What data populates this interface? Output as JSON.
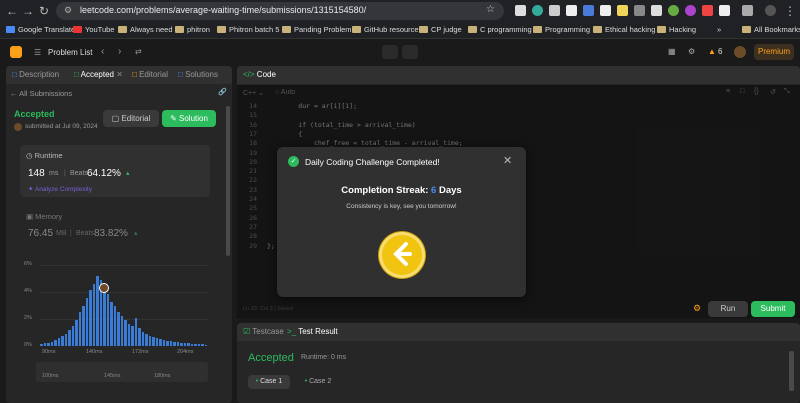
{
  "browser": {
    "url": "leetcode.com/problems/average-waiting-time/submissions/1315154580/",
    "bookmarks": [
      {
        "label": "Google Translate"
      },
      {
        "label": "YouTube"
      },
      {
        "label": "Always need"
      },
      {
        "label": "phitron"
      },
      {
        "label": "Phitron batch 5"
      },
      {
        "label": "Panding Problem"
      },
      {
        "label": "GitHub resource"
      },
      {
        "label": "CP judge"
      },
      {
        "label": "C programming"
      },
      {
        "label": "Programming"
      },
      {
        "label": "Ethical hacking"
      },
      {
        "label": "Hacking"
      }
    ],
    "all_bookmarks": "All Bookmarks",
    "overflow": "»"
  },
  "header": {
    "problem_list": "Problem List",
    "streak": "6",
    "premium": "Premium"
  },
  "left": {
    "tabs": [
      "Description",
      "Accepted",
      "Editorial",
      "Solutions"
    ],
    "back": "All Submissions",
    "status": "Accepted",
    "submitted": "submitted at Jul 09, 2024",
    "editorial_btn": "Editorial",
    "solution_btn": "Solution",
    "runtime": {
      "label": "Runtime",
      "value": "148",
      "unit": "ms",
      "beats_label": "Beats",
      "beats": "64.12%",
      "analyze": "Analyze Complexity"
    },
    "memory": {
      "label": "Memory",
      "value": "76.45",
      "unit": "MB",
      "beats_label": "Beats",
      "beats": "83.82%"
    },
    "chart": {
      "y_ticks": [
        "6%",
        "4%",
        "2%",
        "0%"
      ],
      "x_ticks": [
        "90ms",
        "140ms",
        "172ms",
        "204ms"
      ],
      "mini_ticks": [
        "100ms",
        "145ms",
        "180ms"
      ]
    }
  },
  "code": {
    "title": "Code",
    "language": "C++",
    "mode": "Auto",
    "line_numbers": [
      "14",
      "15",
      "16",
      "17",
      "18",
      "19",
      "20",
      "21",
      "22",
      "23",
      "24",
      "25",
      "26",
      "27",
      "28",
      "29"
    ],
    "lines": [
      "        dur = ar[i][1];",
      "",
      "        if (total_time > arrival_time)",
      "        {",
      "            chef_free = total_time - arrival_time;",
      "",
      "",
      "",
      "",
      "",
      "",
      "",
      "",
      "",
      "",
      "};"
    ],
    "status": "Ln 29, Col 3",
    "saved": "Saved",
    "run": "Run",
    "submit": "Submit"
  },
  "bottom": {
    "tabs": [
      "Testcase",
      "Test Result"
    ],
    "result": "Accepted",
    "runtime": "Runtime: 0 ms",
    "cases": [
      "Case 1",
      "Case 2"
    ]
  },
  "modal": {
    "title": "Daily Coding Challenge Completed!",
    "streak_label": "Completion Streak:",
    "streak_count": "6",
    "streak_unit": "Days",
    "message": "Consistency is key, see you tomorrow!"
  },
  "colors": {
    "accent_green": "#2cbb5d",
    "accent_orange": "#ffa116",
    "accent_blue": "#3a7bd5"
  }
}
